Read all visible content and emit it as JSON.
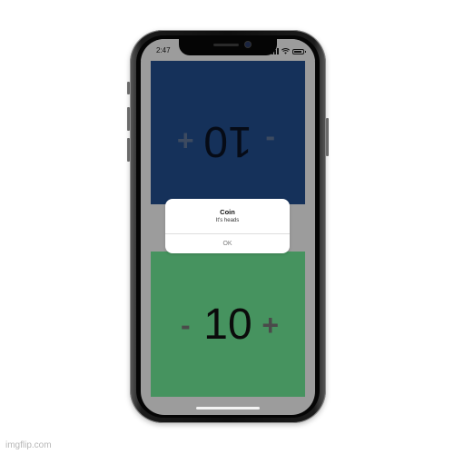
{
  "status_bar": {
    "time": "2:47"
  },
  "top_player": {
    "minus_label": "-",
    "value": "10",
    "plus_label": "+",
    "background_color": "#15315a"
  },
  "bottom_player": {
    "minus_label": "-",
    "value": "10",
    "plus_label": "+",
    "background_color": "#46935f"
  },
  "alert": {
    "title": "Coin",
    "message": "It's heads",
    "button_label": "OK"
  },
  "watermark": {
    "text": "imgflip.com"
  }
}
